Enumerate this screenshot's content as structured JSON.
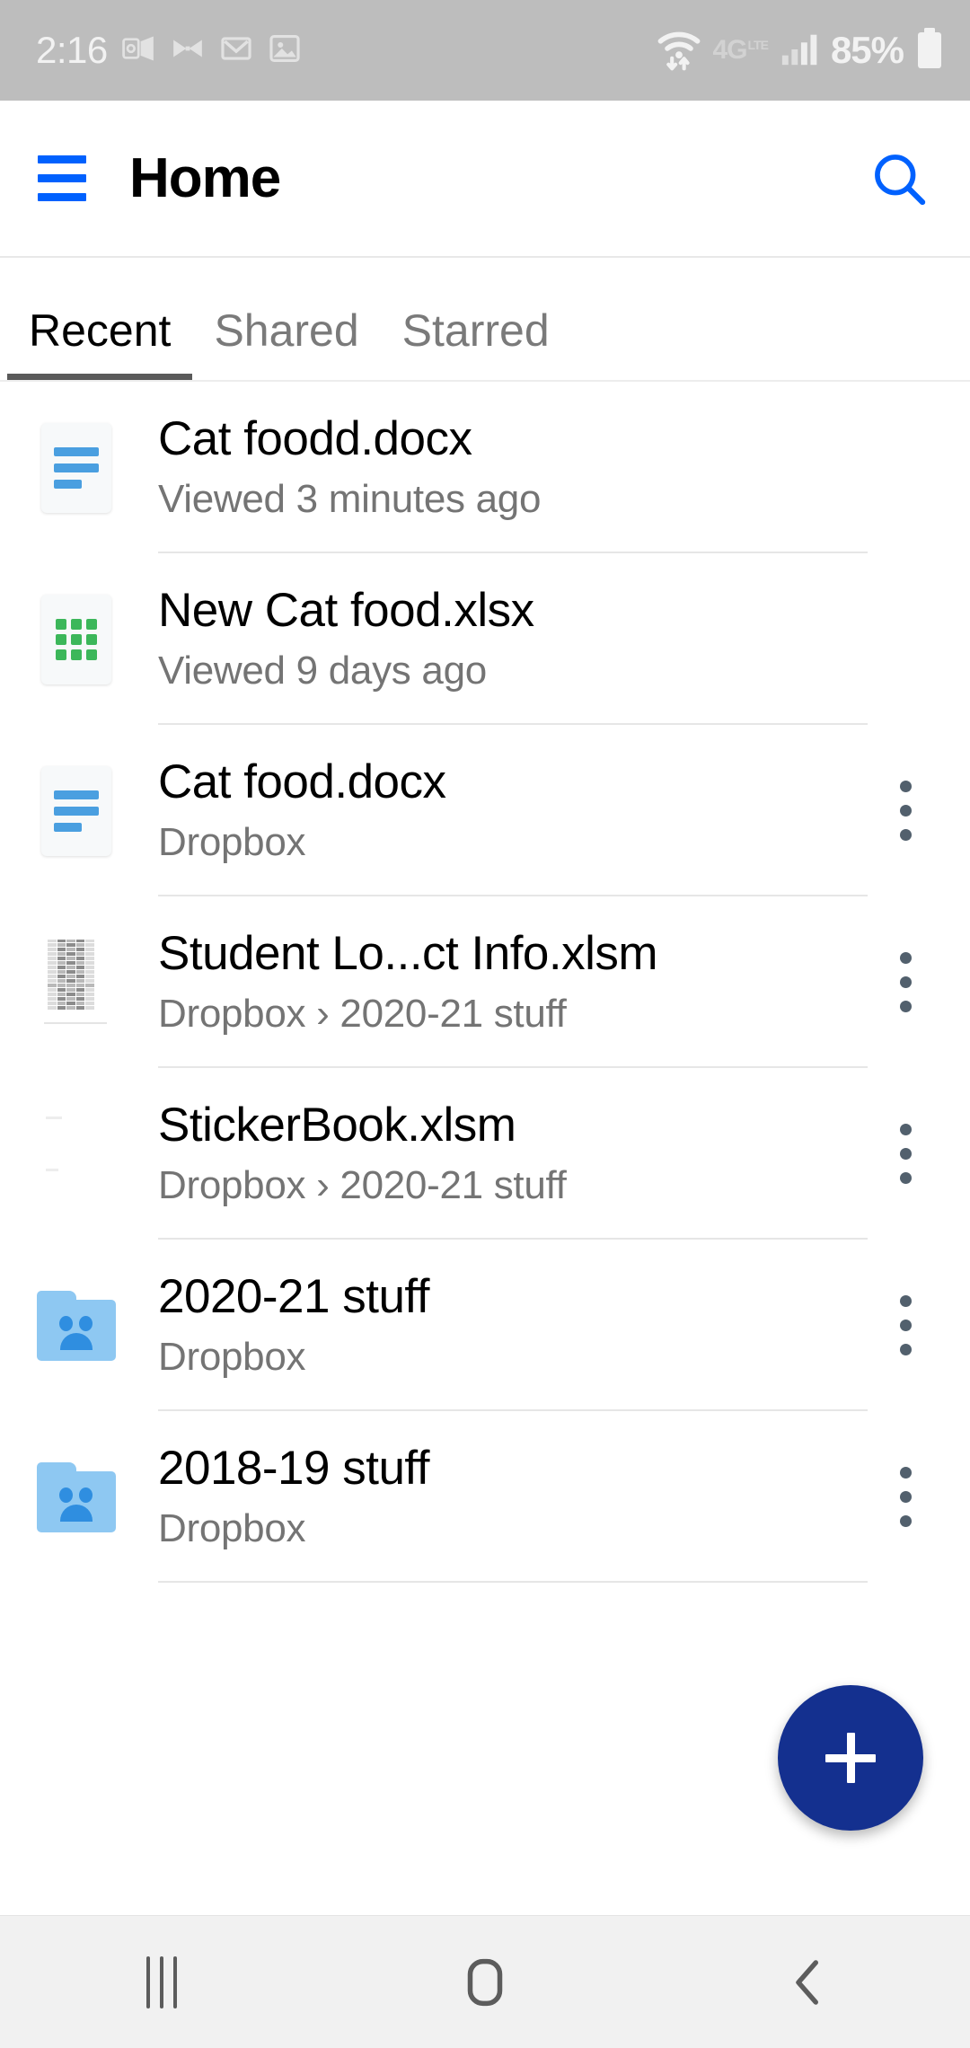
{
  "status_bar": {
    "time": "2:16",
    "left_icons": [
      "outlook-icon",
      "bowtie-app-icon",
      "gmail-icon",
      "gallery-icon"
    ],
    "network_label": "4G",
    "network_sub": "LTE",
    "battery_percent": "85%",
    "right_icons": [
      "wifi-icon",
      "signal-bars-icon",
      "battery-icon"
    ],
    "background_color": "#bdbdbd",
    "foreground_color": "#f2f2f2"
  },
  "app_bar": {
    "title": "Home",
    "menu_icon": "hamburger-menu-icon",
    "search_icon": "search-icon",
    "accent_color": "#0061fe"
  },
  "tabs": {
    "items": [
      {
        "label": "Recent",
        "active": true
      },
      {
        "label": "Shared",
        "active": false
      },
      {
        "label": "Starred",
        "active": false
      }
    ],
    "active_index": 0,
    "indicator_color": "#5a5a5a"
  },
  "file_list": {
    "items": [
      {
        "name": "Cat foodd.docx",
        "subtitle": "Viewed 3 minutes ago",
        "icon": "word-document-icon",
        "icon_type": "doc",
        "has_overflow": false
      },
      {
        "name": "New Cat food.xlsx",
        "subtitle": "Viewed 9 days ago",
        "icon": "excel-spreadsheet-icon",
        "icon_type": "xls",
        "has_overflow": false
      },
      {
        "name": "Cat food.docx",
        "subtitle": "Dropbox",
        "icon": "word-document-icon",
        "icon_type": "doc",
        "has_overflow": true
      },
      {
        "name": "Student Lo...ct Info.xlsm",
        "subtitle": "Dropbox › 2020-21 stuff",
        "icon": "spreadsheet-thumbnail-icon",
        "icon_type": "thumb",
        "has_overflow": true
      },
      {
        "name": "StickerBook.xlsm",
        "subtitle": "Dropbox › 2020-21 stuff",
        "icon": "blank-thumbnail-icon",
        "icon_type": "thumb-faint",
        "has_overflow": true
      },
      {
        "name": "2020-21 stuff",
        "subtitle": "Dropbox",
        "icon": "shared-folder-icon",
        "icon_type": "folder",
        "has_overflow": true
      },
      {
        "name": "2018-19 stuff",
        "subtitle": "Dropbox",
        "icon": "shared-folder-icon",
        "icon_type": "folder",
        "has_overflow": true
      }
    ]
  },
  "fab": {
    "icon": "plus-icon",
    "color": "#14308f"
  },
  "nav_bar": {
    "recents_icon": "recents-icon",
    "home_icon": "home-icon",
    "back_icon": "back-icon",
    "background_color": "#f1f1f1",
    "icon_color": "#5c5c5c"
  }
}
